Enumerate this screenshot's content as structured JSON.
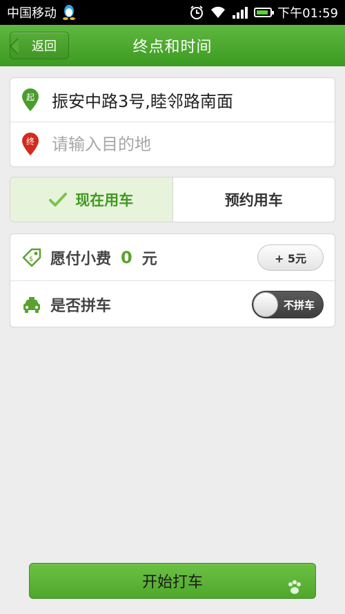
{
  "status_bar": {
    "carrier": "中国移动",
    "time": "下午01:59"
  },
  "header": {
    "back_label": "返回",
    "title": "终点和时间"
  },
  "address": {
    "start_badge": "起",
    "start_text": "振安中路3号,睦邻路南面",
    "dest_badge": "终",
    "dest_placeholder": "请输入目的地"
  },
  "mode": {
    "now_label": "现在用车",
    "reserve_label": "预约用车",
    "selected": "now"
  },
  "options": {
    "tip_label": "愿付小费",
    "tip_value": "0",
    "tip_unit": "元",
    "add_tip_label": "+ 5元",
    "carpool_label": "是否拼车",
    "carpool_toggle_label": "不拼车",
    "carpool_on": false
  },
  "footer": {
    "start_button_label": "开始打车"
  },
  "colors": {
    "accent_green": "#4ea72b",
    "title_green": "#3c9a21",
    "start_pin": "#4a9d2c",
    "dest_pin": "#d22b1c"
  }
}
